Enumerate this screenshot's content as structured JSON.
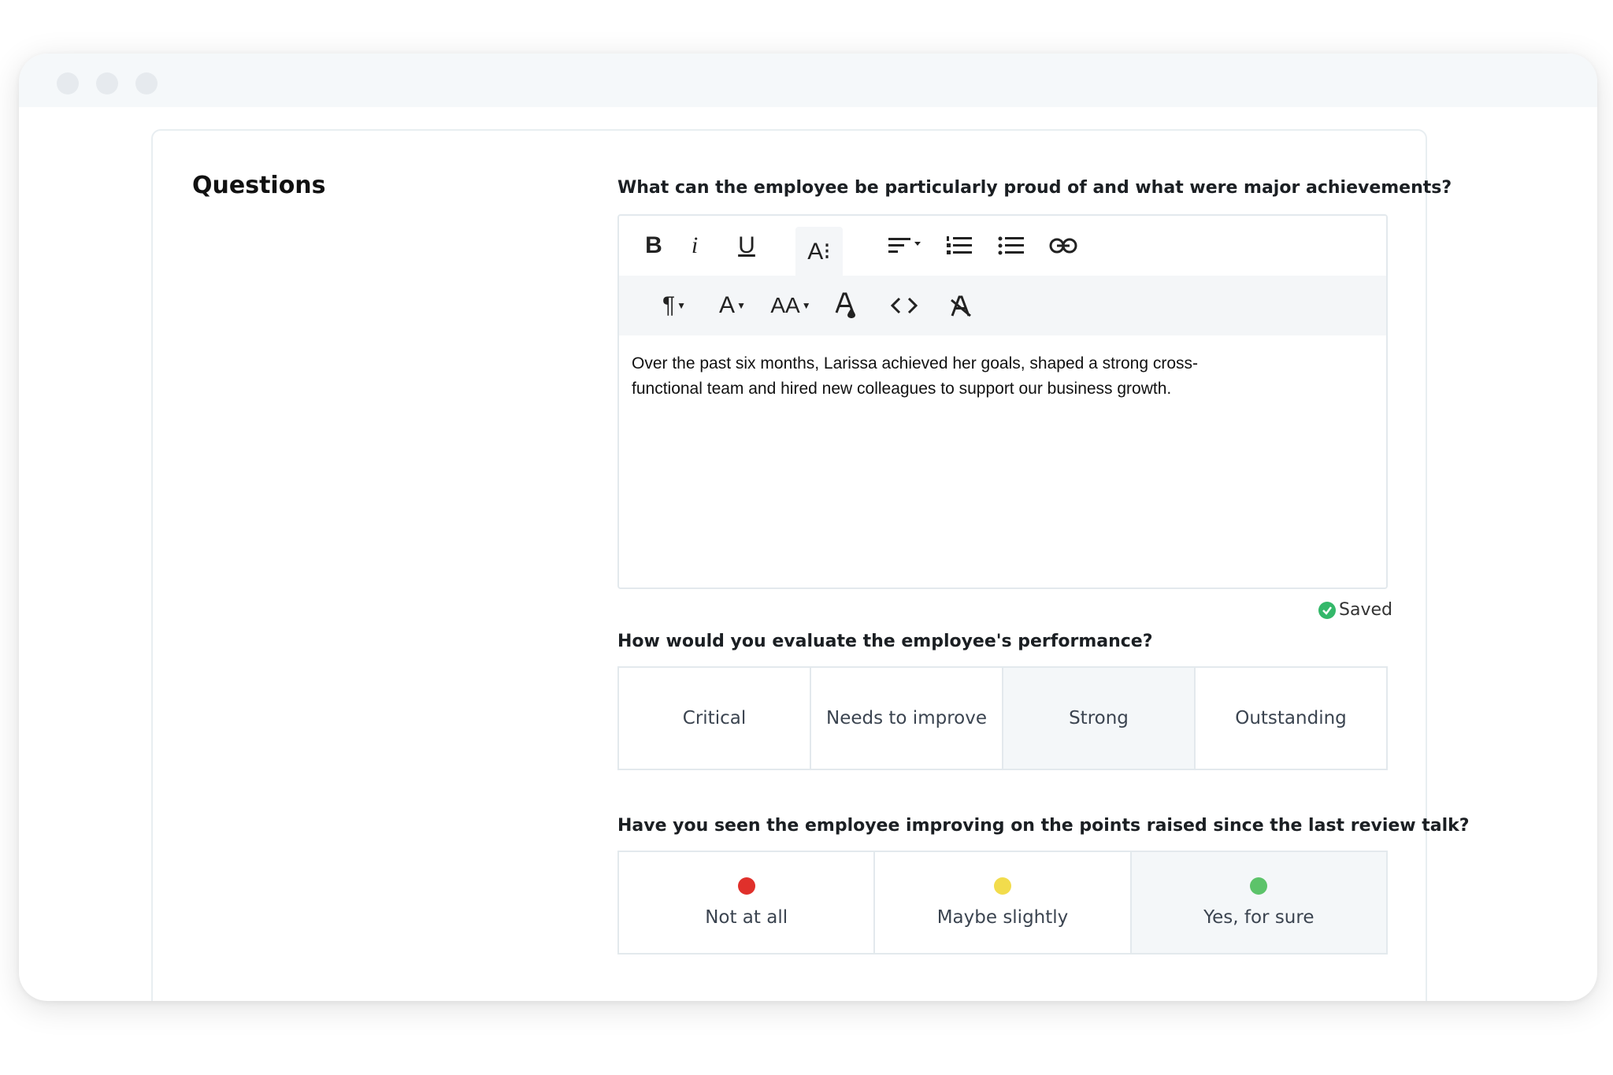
{
  "section_title": "Questions",
  "questions": {
    "q1": {
      "label": "What can the employee be particularly proud of and what were major achievements?",
      "answer_line1": "Over the past six months, Larissa achieved her goals, shaped a strong cross-",
      "answer_line2": "functional team and hired new colleagues to support our business growth.",
      "status": "Saved"
    },
    "q2": {
      "label": "How would you evaluate the employee's performance?",
      "options": [
        "Critical",
        "Needs to improve",
        "Strong",
        "Outstanding"
      ],
      "selected": "Strong"
    },
    "q3": {
      "label": "Have you seen the employee improving on the points raised since the last review talk?",
      "options": [
        {
          "label": "Not at all",
          "color": "#e0302b"
        },
        {
          "label": "Maybe slightly",
          "color": "#f2dc4c"
        },
        {
          "label": "Yes, for sure",
          "color": "#5cc36a"
        }
      ],
      "selected": "Yes, for sure"
    }
  },
  "toolbar": {
    "row1": [
      "bold-icon",
      "italic-icon",
      "underline-icon",
      "font-size-icon",
      "align-icon",
      "ordered-list-icon",
      "unordered-list-icon",
      "link-icon"
    ],
    "row2": [
      "paragraph-format-icon",
      "font-family-icon",
      "font-size-dropdown-icon",
      "text-color-icon",
      "code-view-icon",
      "clear-formatting-icon"
    ],
    "bold": "B",
    "italic": "i",
    "underline": "U",
    "font_size": "A⁝",
    "paragraph": "¶",
    "font_family": "A",
    "font_size_dd": "AA",
    "code": "<>"
  },
  "colors": {
    "saved_check": "#34b86a",
    "selected_bg": "#f4f7f9"
  }
}
